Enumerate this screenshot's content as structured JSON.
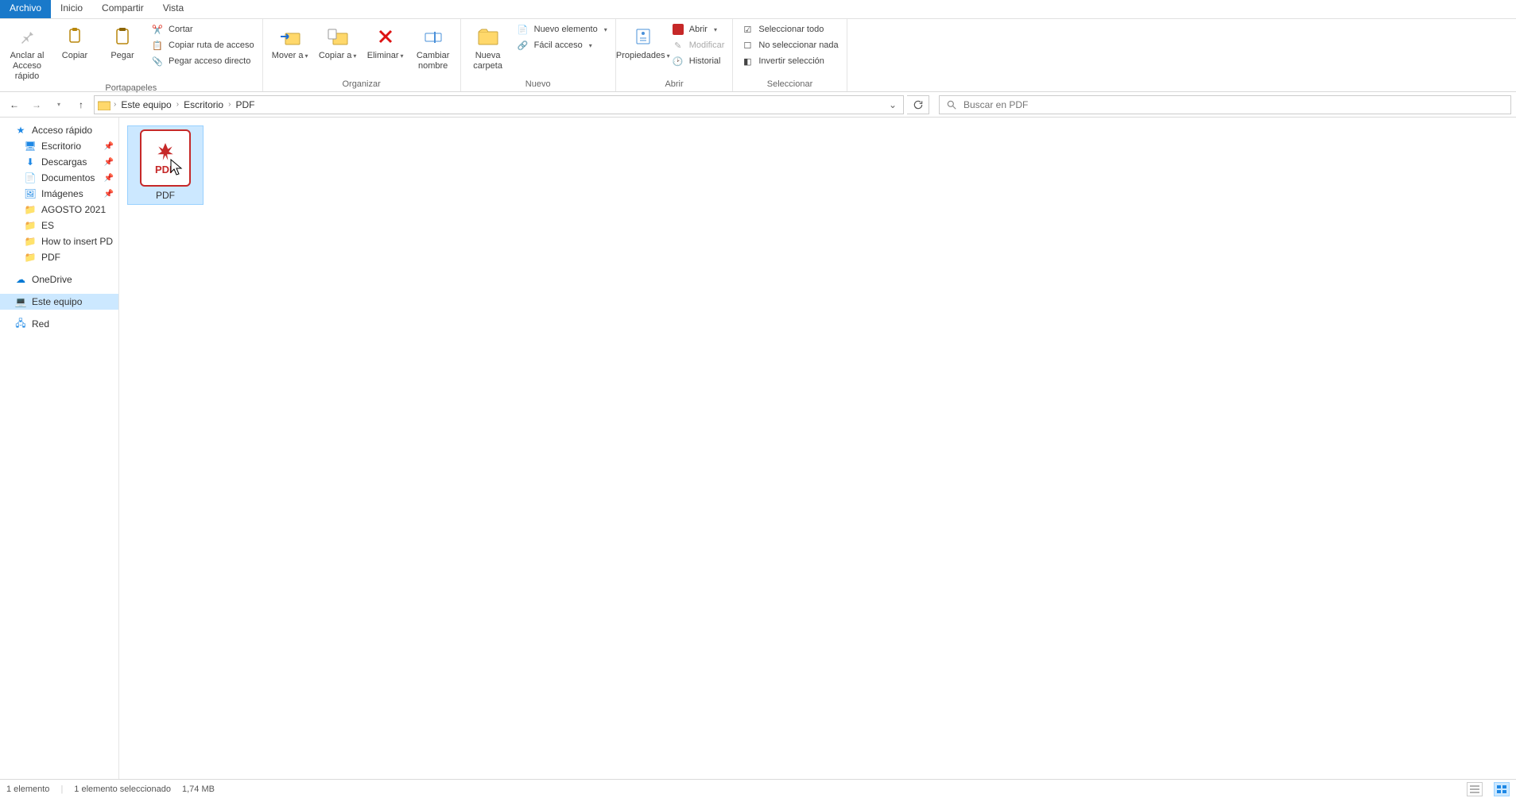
{
  "tabs": {
    "file": "Archivo",
    "home": "Inicio",
    "share": "Compartir",
    "view": "Vista"
  },
  "ribbon": {
    "clipboard": {
      "pin": "Anclar al Acceso rápido",
      "copy": "Copiar",
      "paste": "Pegar",
      "cut": "Cortar",
      "copy_path": "Copiar ruta de acceso",
      "paste_shortcut": "Pegar acceso directo",
      "group": "Portapapeles"
    },
    "organize": {
      "move": "Mover a",
      "copy_to": "Copiar a",
      "delete": "Eliminar",
      "rename": "Cambiar nombre",
      "group": "Organizar"
    },
    "new": {
      "new_folder": "Nueva carpeta",
      "new_item": "Nuevo elemento",
      "easy_access": "Fácil acceso",
      "group": "Nuevo"
    },
    "open": {
      "properties": "Propiedades",
      "open": "Abrir",
      "modify": "Modificar",
      "history": "Historial",
      "group": "Abrir"
    },
    "select": {
      "select_all": "Seleccionar todo",
      "select_none": "No seleccionar nada",
      "invert": "Invertir selección",
      "group": "Seleccionar"
    }
  },
  "breadcrumb": {
    "items": [
      "Este equipo",
      "Escritorio",
      "PDF"
    ]
  },
  "search": {
    "placeholder": "Buscar en PDF"
  },
  "sidebar": {
    "quick_access": "Acceso rápido",
    "desktop": "Escritorio",
    "downloads": "Descargas",
    "documents": "Documentos",
    "pictures": "Imágenes",
    "agosto": "AGOSTO 2021",
    "es": "ES",
    "howto": "How to insert PDF in",
    "pdf": "PDF",
    "onedrive": "OneDrive",
    "this_pc": "Este equipo",
    "network": "Red"
  },
  "files": [
    {
      "name": "PDF"
    }
  ],
  "status": {
    "count": "1 elemento",
    "selected": "1 elemento seleccionado",
    "size": "1,74 MB"
  }
}
